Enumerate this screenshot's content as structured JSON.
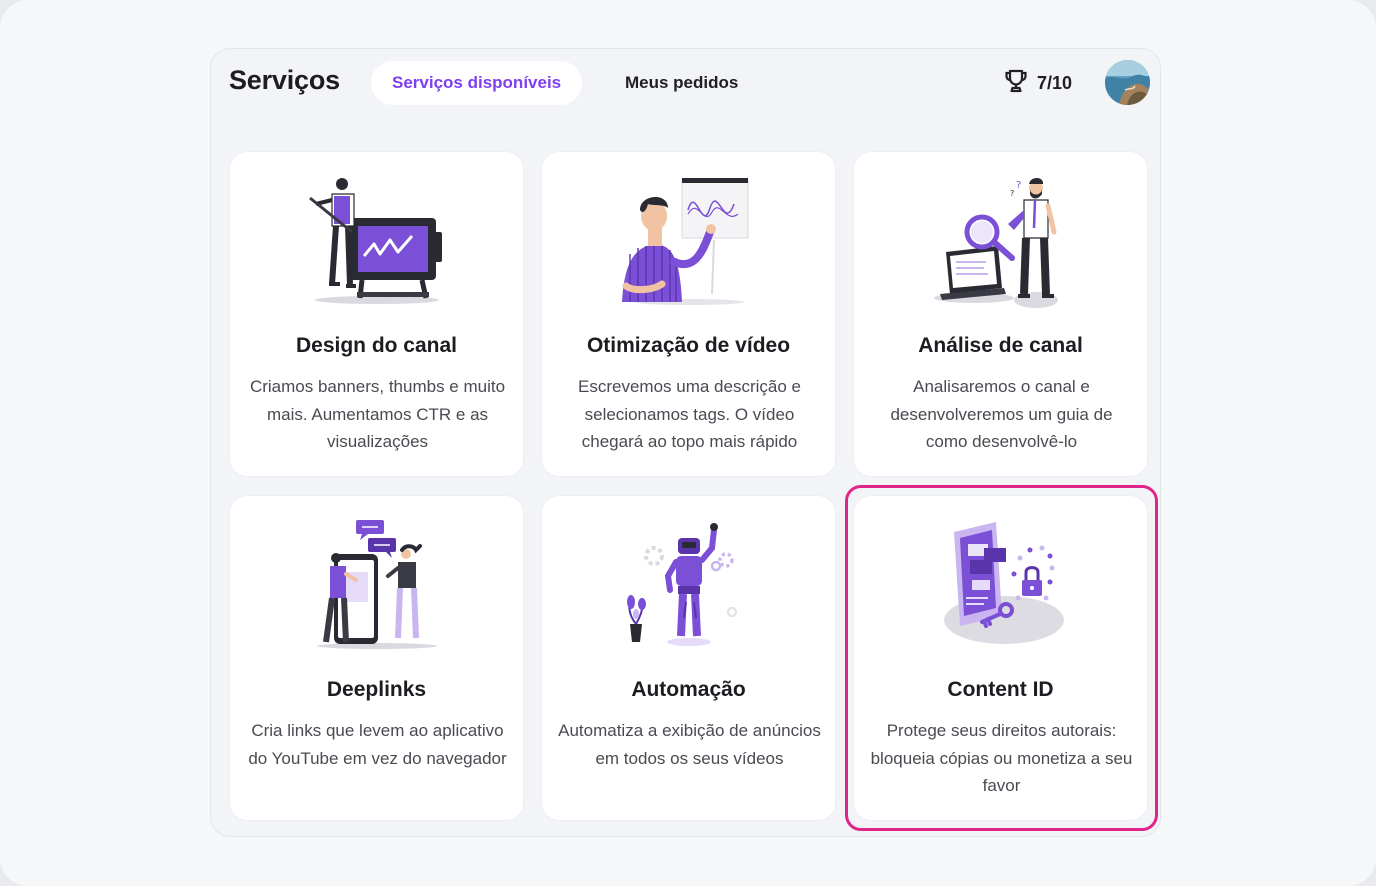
{
  "header": {
    "title": "Serviços",
    "tabs": [
      {
        "label": "Serviços disponíveis",
        "active": true
      },
      {
        "label": "Meus pedidos",
        "active": false
      }
    ],
    "score": "7/10",
    "score_icon": "trophy-icon",
    "avatar": "user-avatar"
  },
  "colors": {
    "accent": "#7f3ff0",
    "highlight": "#e0258a",
    "illustration_purple": "#7b4fd6"
  },
  "services": [
    {
      "title": "Design do canal",
      "description": "Criamos banners, thumbs e muito mais. Aumentamos CTR e as visualizações",
      "icon": "designer-drawing-icon"
    },
    {
      "title": "Otimização de vídeo",
      "description": "Escrevemos uma descrição e selecionamos tags. O vídeo chegará ao topo mais rápido",
      "icon": "presenter-chart-icon"
    },
    {
      "title": "Análise de canal",
      "description": "Analisaremos o canal e desenvolveremos um guia de como desenvolvê-lo",
      "icon": "magnifier-analysis-icon"
    },
    {
      "title": "Deeplinks",
      "description": "Cria links que levem ao aplicativo do YouTube em vez do navegador",
      "icon": "phone-chat-icon"
    },
    {
      "title": "Automação",
      "description": "Automatiza a exibição de anúncios em todos os seus vídeos",
      "icon": "robot-icon"
    },
    {
      "title": "Content ID",
      "description": "Protege seus direitos autorais: bloqueia cópias ou monetiza a seu favor",
      "icon": "lock-key-shield-icon",
      "highlighted": true
    }
  ]
}
